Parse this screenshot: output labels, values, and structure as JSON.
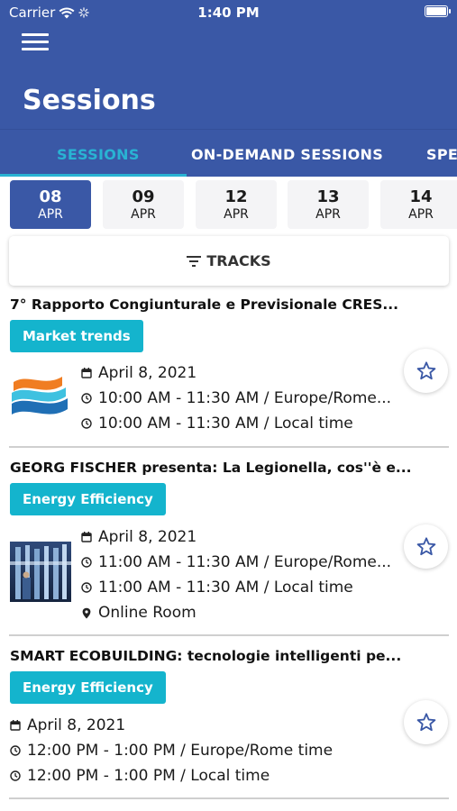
{
  "status_bar": {
    "carrier": "Carrier",
    "time": "1:40 PM"
  },
  "header": {
    "title": "Sessions"
  },
  "tabs": [
    {
      "label": "SESSIONS",
      "active": true
    },
    {
      "label": "ON-DEMAND SESSIONS",
      "active": false
    },
    {
      "label": "SPEA",
      "active": false
    }
  ],
  "dates": [
    {
      "day": "08",
      "month": "APR",
      "active": true
    },
    {
      "day": "09",
      "month": "APR",
      "active": false
    },
    {
      "day": "12",
      "month": "APR",
      "active": false
    },
    {
      "day": "13",
      "month": "APR",
      "active": false
    },
    {
      "day": "14",
      "month": "APR",
      "active": false
    }
  ],
  "tracks_button": {
    "label": "TRACKS",
    "icon": "filter-icon"
  },
  "sessions": [
    {
      "title": "7° Rapporto Congiunturale e Previsionale CRES...",
      "tag": "Market trends",
      "date": "April 8, 2021",
      "time_rome": "10:00 AM - 11:30 AM / Europe/Rome...",
      "time_local": "10:00 AM - 11:30 AM / Local time",
      "thumbnail": "logo-waves"
    },
    {
      "title": "GEORG FISCHER presenta: La Legionella, cos''è e...",
      "tag": "Energy Efficiency",
      "date": "April 8, 2021",
      "time_rome": "11:00 AM - 11:30 AM / Europe/Rome...",
      "time_local": "11:00 AM - 11:30 AM / Local time",
      "location": "Online Room",
      "thumbnail": "photo-pipes"
    },
    {
      "title": "SMART ECOBUILDING: tecnologie intelligenti pe...",
      "tag": "Energy Efficiency",
      "date": "April 8, 2021",
      "time_rome": "12:00 PM - 1:00 PM / Europe/Rome time",
      "time_local": "12:00 PM - 1:00 PM / Local time"
    }
  ],
  "colors": {
    "primary": "#3a58a6",
    "accent": "#29b3d3",
    "tag": "#14b4cd"
  }
}
